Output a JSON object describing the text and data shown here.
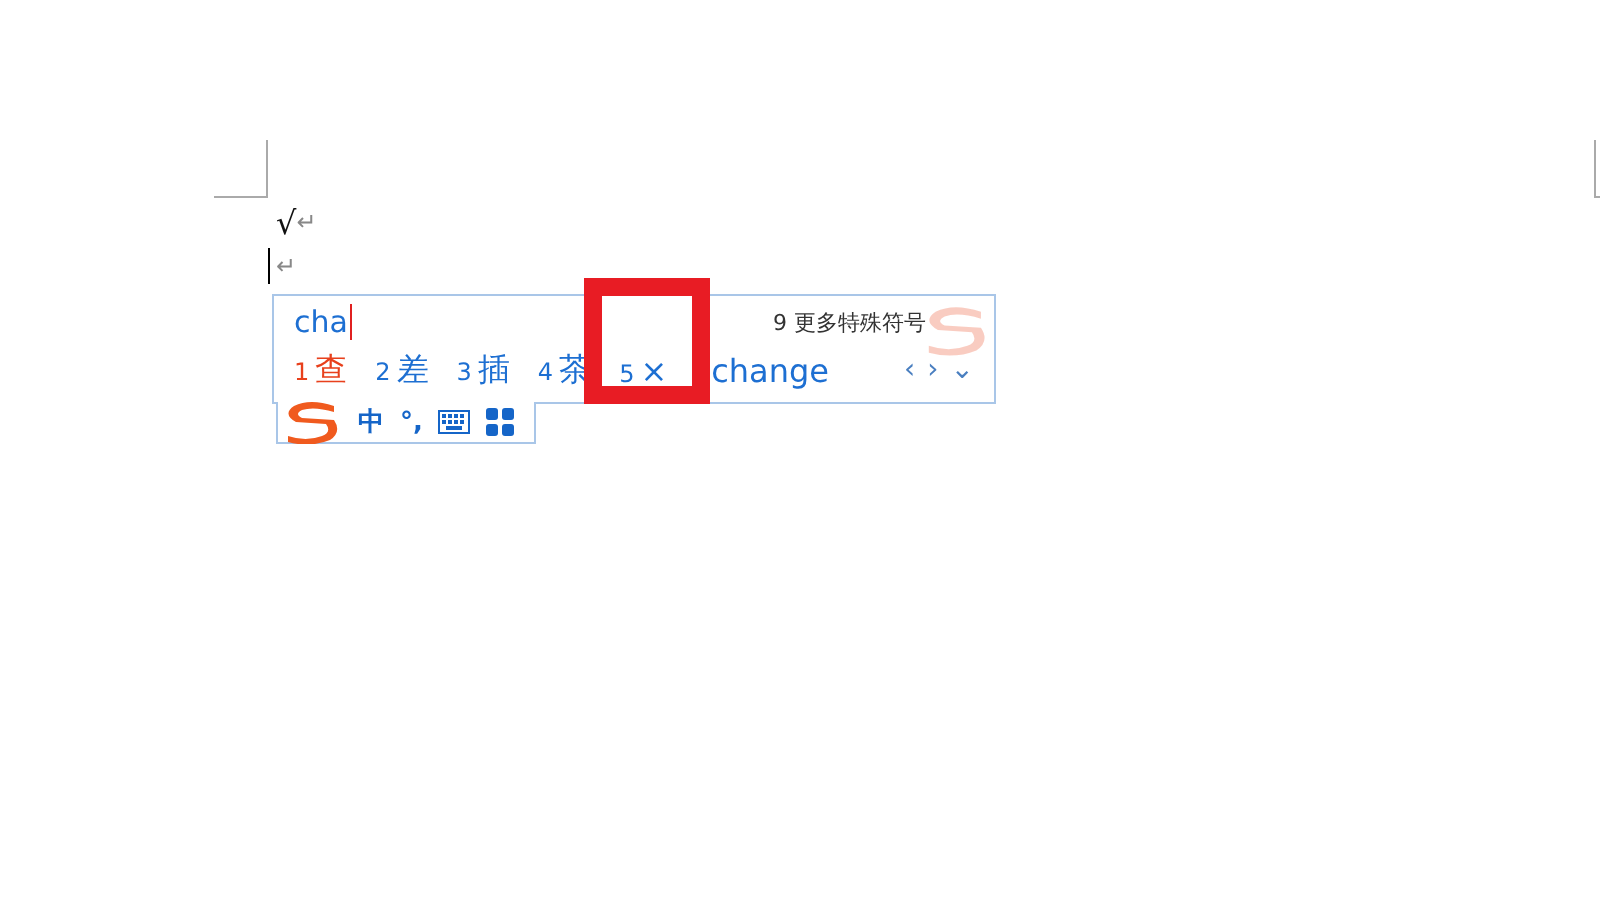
{
  "document": {
    "lines": [
      {
        "text": "√",
        "paragraph_mark": "↵"
      },
      {
        "paragraph_mark": "↵",
        "cursor": true
      }
    ]
  },
  "ime": {
    "composition": "cha",
    "more": {
      "num": "9",
      "label": "更多特殊符号"
    },
    "candidates": [
      {
        "num": "1",
        "text": "查",
        "selected": true,
        "highlighted": false
      },
      {
        "num": "2",
        "text": "差",
        "selected": false,
        "highlighted": false
      },
      {
        "num": "3",
        "text": "插",
        "selected": false,
        "highlighted": false
      },
      {
        "num": "4",
        "text": "茶",
        "selected": false,
        "highlighted": false
      },
      {
        "num": "5",
        "text": "×",
        "selected": false,
        "highlighted": true
      },
      {
        "text": "change",
        "selected": false,
        "highlighted": false
      }
    ],
    "nav": [
      "‹",
      "›",
      "⌄"
    ],
    "toolbar": {
      "mode": "中",
      "punct": "°,"
    }
  }
}
